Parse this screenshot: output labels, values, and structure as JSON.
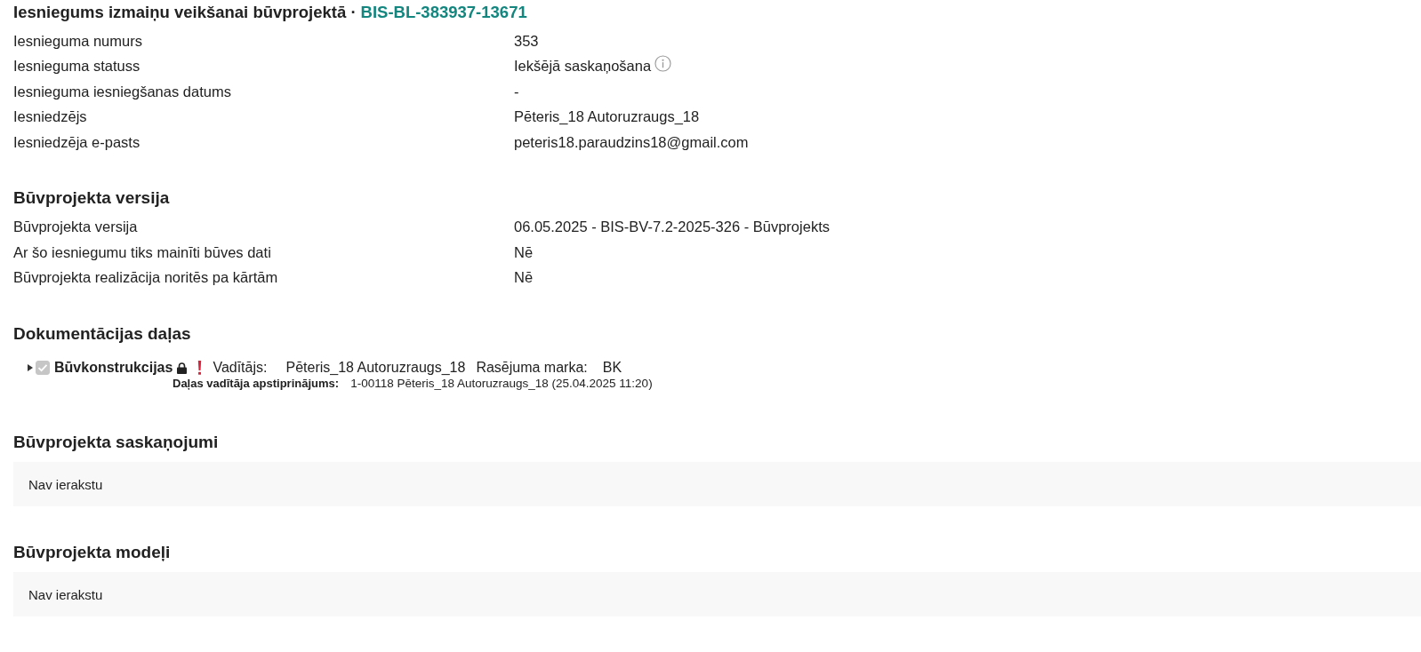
{
  "title": {
    "text": "Iesniegums izmaiņu veikšanai būvprojektā ·",
    "code": "BIS-BL-383937-13671"
  },
  "details": [
    {
      "label": "Iesnieguma numurs",
      "value": "353",
      "kind": "plain"
    },
    {
      "label": "Iesnieguma statuss",
      "value": "Iekšējā saskaņošana",
      "kind": "info"
    },
    {
      "label": "Iesnieguma iesniegšanas datums",
      "value": "-",
      "kind": "plain"
    },
    {
      "label": "Iesniedzējs",
      "value": "Pēteris_18 Autoruzraugs_18",
      "kind": "plain"
    },
    {
      "label": "Iesniedzēja e-pasts",
      "value": "peteris18.paraudzins18@gmail.com",
      "kind": "plain"
    }
  ],
  "version_section": {
    "heading": "Būvprojekta versija",
    "rows": [
      {
        "label": "Būvprojekta versija",
        "value": "06.05.2025 - BIS-BV-7.2-2025-326 - Būvprojekts"
      },
      {
        "label": "Ar šo iesniegumu tiks mainīti būves dati",
        "value": "Nē"
      },
      {
        "label": "Būvprojekta realizācija noritēs pa kārtām",
        "value": "Nē"
      }
    ]
  },
  "documentation": {
    "heading": "Dokumentācijas daļas",
    "parts": [
      {
        "name": "Būvkonstrukcijas",
        "expanded": false,
        "checked": true,
        "disabled": true,
        "locked": true,
        "warning": true,
        "manager_label": "Vadītājs:",
        "manager": "Pēteris_18 Autoruzraugs_18",
        "mark_label": "Rasējuma marka:",
        "mark": "BK",
        "approval_label": "Daļas vadītāja apstiprinājums:",
        "approval": "1-00118 Pēteris_18 Autoruzraugs_18 (25.04.2025 11:20)"
      }
    ]
  },
  "approvals": {
    "heading": "Būvprojekta saskaņojumi",
    "empty_text": "Nav ierakstu"
  },
  "models": {
    "heading": "Būvprojekta modeļi",
    "empty_text": "Nav ierakstu"
  }
}
